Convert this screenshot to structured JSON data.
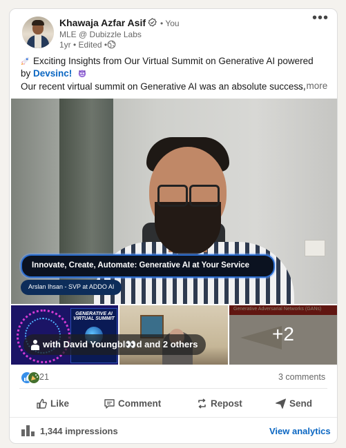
{
  "post": {
    "author": "Khawaja Azfar Asif",
    "you_label": "• You",
    "headline": "MLE @ Dubizzle Labs",
    "meta": "1yr • Edited •",
    "line1": "Exciting Insights from Our Virtual Summit on Generative AI powered",
    "line2_prefix": "by ",
    "mention": "Devsinc!",
    "line3": "Our recent virtual summit on Generative AI was an absolute success,",
    "see_more": "…more"
  },
  "media": {
    "lower_third": "Innovate, Create, Automate: Generative AI at Your Service",
    "speaker": "Arslan Ihsan - SVP at ADDO AI",
    "thumb1_title": "GENERATIVE AI VIRTUAL SUMMIT",
    "thumb3_title": "Generative Adversarial Networks (GANs)",
    "more_count": "+2",
    "tags": "with David Youngbl👀d and 2 others"
  },
  "social": {
    "reaction_count": "21",
    "comments": "3 comments"
  },
  "actions": {
    "like": "Like",
    "comment": "Comment",
    "repost": "Repost",
    "send": "Send"
  },
  "footer": {
    "impressions": "1,344 impressions",
    "view_analytics": "View analytics"
  },
  "icons": [
    "verified-icon",
    "globe-icon",
    "more-options-icon",
    "rocket-emoji-icon",
    "face-emoji-icon",
    "person-tag-icon",
    "like-reaction-icon",
    "celebrate-reaction-icon",
    "like-icon",
    "comment-icon",
    "repost-icon",
    "send-icon",
    "analytics-icon"
  ],
  "colors": {
    "link": "#0a66c2",
    "text_muted": "#666666",
    "like_blue": "#378fe9"
  }
}
